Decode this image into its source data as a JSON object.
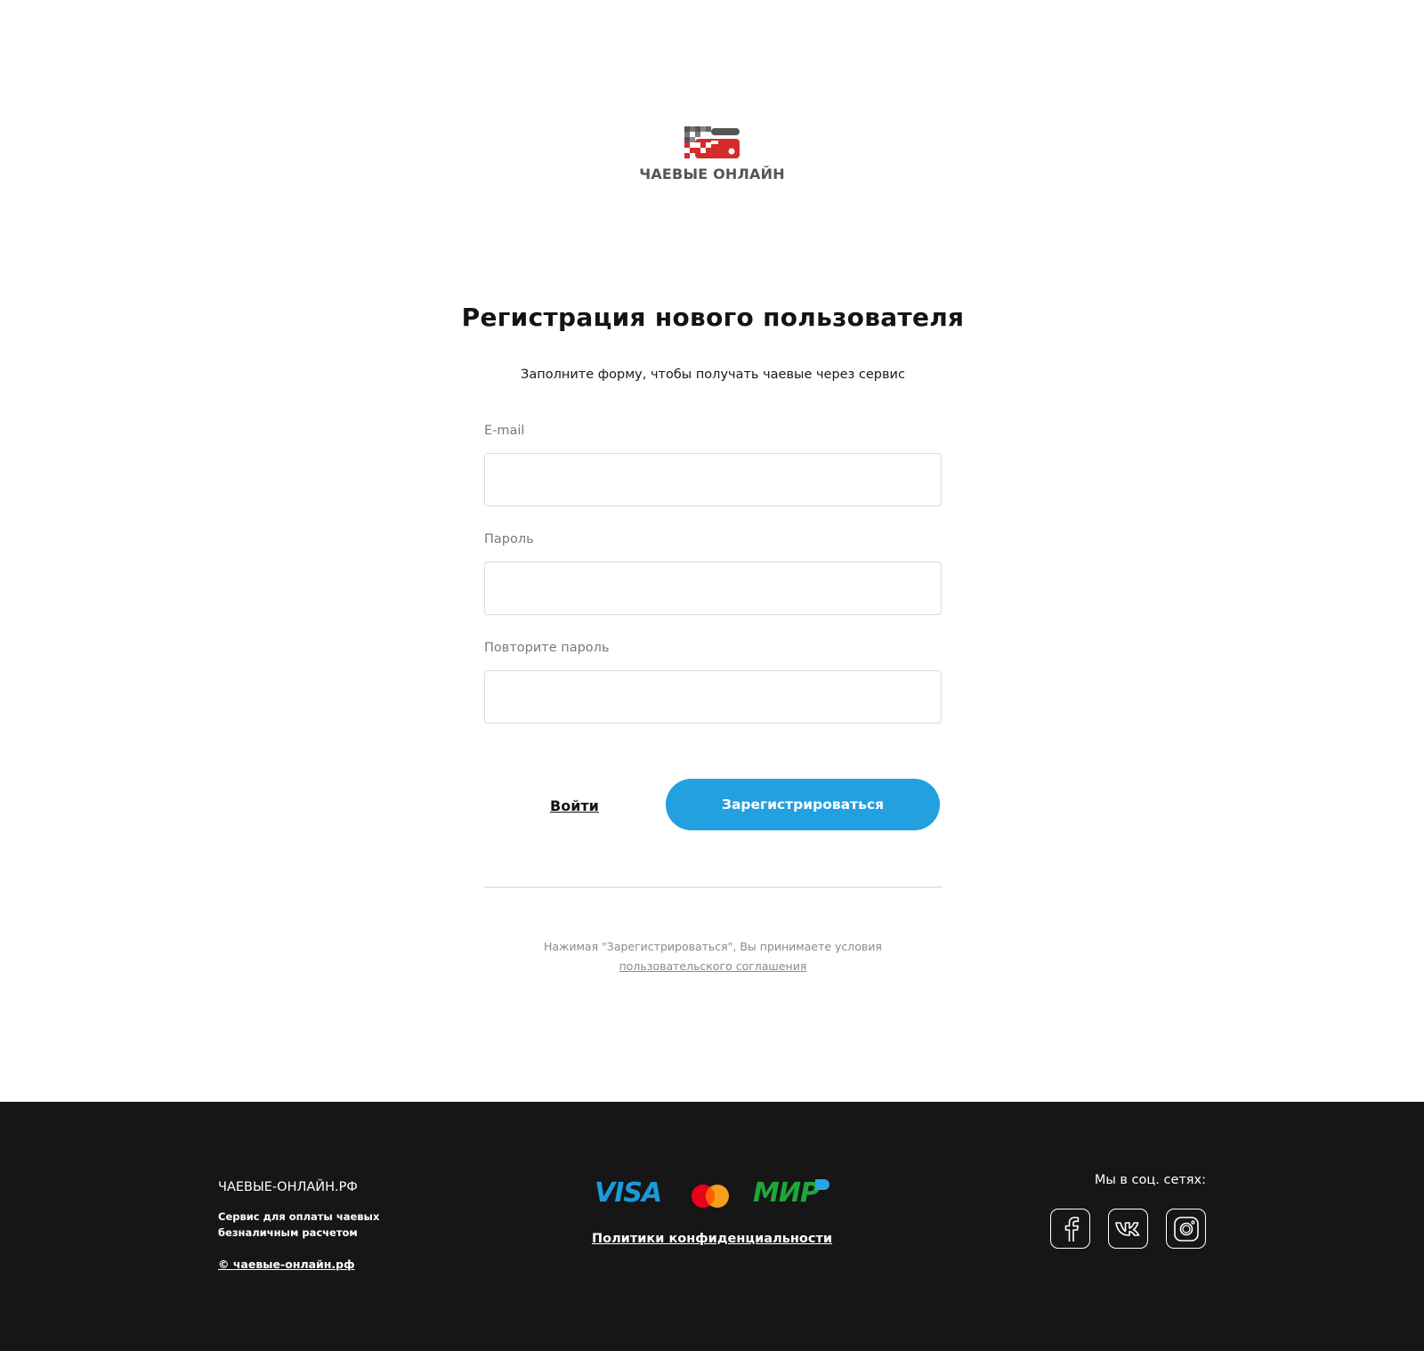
{
  "brand": {
    "logo_text": "ЧАЕВЫЕ ОНЛАЙН"
  },
  "form": {
    "title": "Регистрация нового пользователя",
    "subtitle": "Заполните форму, чтобы получать чаевые через сервис",
    "fields": [
      {
        "label": "E-mail",
        "value": "",
        "type": "email"
      },
      {
        "label": "Пароль",
        "value": "",
        "type": "password"
      },
      {
        "label": "Повторите пароль",
        "value": "",
        "type": "password"
      }
    ],
    "login_label": "Войти",
    "register_label": "Зарегистрироваться",
    "terms_text": "Нажимая \"Зарегистрироваться\", Вы принимаете условия",
    "terms_link": "пользовательского соглашения"
  },
  "footer": {
    "site_name": "ЧАЕВЫЕ-ОНЛАЙН.РФ",
    "description": "Сервис для оплаты чаевых безналичным расчетом",
    "copyright": "© чаевые-онлайн.рф",
    "payment_methods": [
      "visa",
      "mastercard",
      "mir"
    ],
    "payment_labels": {
      "visa": "VISA",
      "mir": "МИР"
    },
    "privacy_label": "Политики конфиденциальности",
    "social_title": "Мы в соц. сетях:",
    "social": [
      "facebook-icon",
      "vk-icon",
      "instagram-icon"
    ]
  },
  "colors": {
    "accent": "#23a0e0",
    "logo_red": "#d42b2b",
    "logo_gray": "#555555",
    "footer_bg": "#161616",
    "visa": "#1a9bd7",
    "mir_green": "#1ea838",
    "mc_red": "#eb001b",
    "mc_orange": "#f79e1b"
  }
}
